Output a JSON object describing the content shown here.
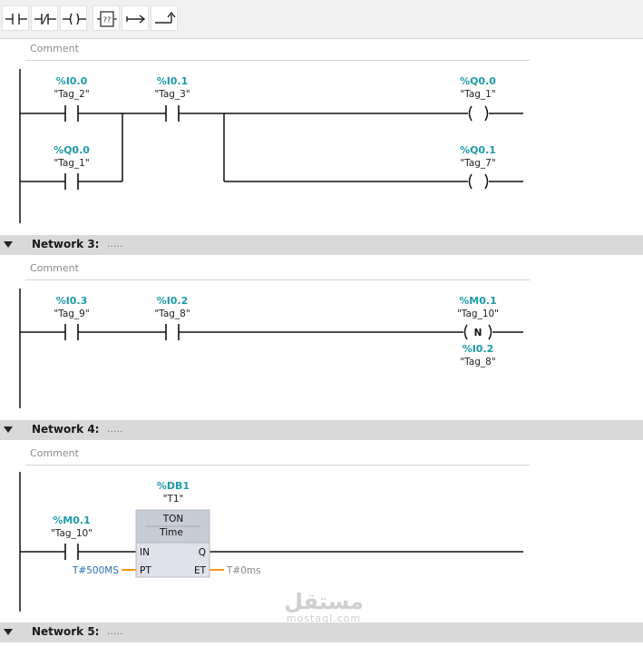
{
  "toolbar": {
    "buttons": [
      {
        "name": "normally-open-contact-icon"
      },
      {
        "name": "normally-closed-contact-icon"
      },
      {
        "name": "output-coil-icon"
      },
      {
        "name": "empty-box-icon"
      },
      {
        "name": "open-branch-icon"
      },
      {
        "name": "close-branch-icon"
      }
    ],
    "box_glyph": "??"
  },
  "network2": {
    "comment": "Comment",
    "contact_i00": {
      "addr": "%I0.0",
      "tag": "\"Tag_2\""
    },
    "contact_i01": {
      "addr": "%I0.1",
      "tag": "\"Tag_3\""
    },
    "contact_q00": {
      "addr": "%Q0.0",
      "tag": "\"Tag_1\""
    },
    "coil_q00": {
      "addr": "%Q0.0",
      "tag": "\"Tag_1\""
    },
    "coil_q01": {
      "addr": "%Q0.1",
      "tag": "\"Tag_7\""
    }
  },
  "network3": {
    "title": "Network 3:",
    "dots": ".....",
    "comment": "Comment",
    "contact_i03": {
      "addr": "%I0.3",
      "tag": "\"Tag_9\""
    },
    "contact_i02": {
      "addr": "%I0.2",
      "tag": "\"Tag_8\""
    },
    "ncoil": {
      "addr": "%M0.1",
      "tag": "\"Tag_10\"",
      "letter": "N",
      "addr2": "%I0.2",
      "tag2": "\"Tag_8\""
    }
  },
  "network4": {
    "title": "Network 4:",
    "dots": ".....",
    "comment": "Comment",
    "contact_m01": {
      "addr": "%M0.1",
      "tag": "\"Tag_10\""
    },
    "timer": {
      "db": "%DB1",
      "instance": "\"T1\"",
      "type": "TON",
      "subtype": "Time",
      "in": "IN",
      "q": "Q",
      "pt": "PT",
      "et": "ET",
      "pt_value": "T#500MS",
      "et_value": "T#0ms"
    }
  },
  "network5": {
    "title": "Network 5:",
    "dots": "....."
  },
  "watermark": {
    "arabic": "مستقل",
    "latin": "mostaql.com"
  },
  "colors": {
    "address": "#1f9aa8",
    "param_line": "#f59a1a",
    "pt_value": "#2a6fb0",
    "et_value": "#888888",
    "rail": "#111111"
  }
}
